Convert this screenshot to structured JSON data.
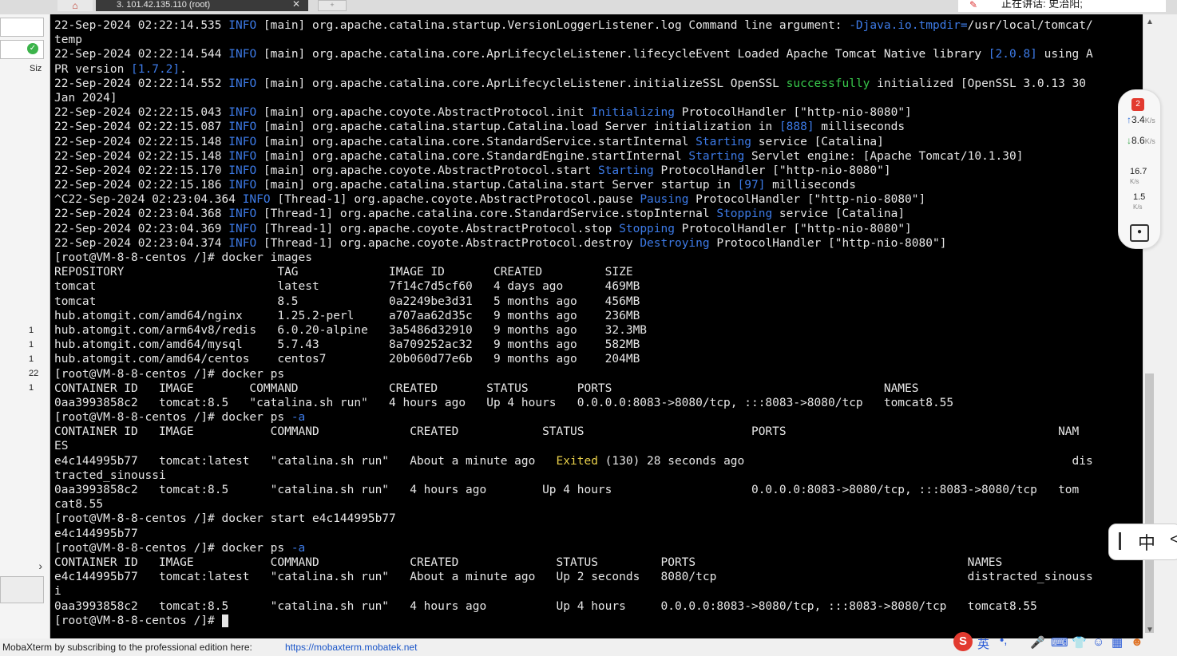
{
  "window": {
    "tab_title": "3. 101.42.135.110 (root)",
    "tab_close": "✕",
    "home_icon": "home-icon",
    "new_tab": "+"
  },
  "overlay": {
    "speaking_label": "正在讲话: 史治阳;"
  },
  "left_panel": {
    "size_label": "Siz",
    "numbers": [
      "1",
      "1",
      "1",
      "22",
      "1"
    ],
    "arrow": "›"
  },
  "terminal_lines": [
    "22-Sep-2024 02:22:14.535 INFO [main] org.apache.catalina.startup.VersionLoggerListener.log Command line argument: -Djava.io.tmpdir=/usr/local/tomcat/",
    "temp",
    "22-Sep-2024 02:22:14.544 INFO [main] org.apache.catalina.core.AprLifecycleListener.lifecycleEvent Loaded Apache Tomcat Native library [2.0.8] using A",
    "PR version [1.7.2].",
    "22-Sep-2024 02:22:14.552 INFO [main] org.apache.catalina.core.AprLifecycleListener.initializeSSL OpenSSL successfully initialized [OpenSSL 3.0.13 30",
    "Jan 2024]",
    "22-Sep-2024 02:22:15.043 INFO [main] org.apache.coyote.AbstractProtocol.init Initializing ProtocolHandler [\"http-nio-8080\"]",
    "22-Sep-2024 02:22:15.087 INFO [main] org.apache.catalina.startup.Catalina.load Server initialization in [888] milliseconds",
    "22-Sep-2024 02:22:15.148 INFO [main] org.apache.catalina.core.StandardService.startInternal Starting service [Catalina]",
    "22-Sep-2024 02:22:15.148 INFO [main] org.apache.catalina.core.StandardEngine.startInternal Starting Servlet engine: [Apache Tomcat/10.1.30]",
    "22-Sep-2024 02:22:15.170 INFO [main] org.apache.coyote.AbstractProtocol.start Starting ProtocolHandler [\"http-nio-8080\"]",
    "22-Sep-2024 02:22:15.186 INFO [main] org.apache.catalina.startup.Catalina.start Server startup in [97] milliseconds",
    "^C22-Sep-2024 02:23:04.364 INFO [Thread-1] org.apache.coyote.AbstractProtocol.pause Pausing ProtocolHandler [\"http-nio-8080\"]",
    "22-Sep-2024 02:23:04.368 INFO [Thread-1] org.apache.catalina.core.StandardService.stopInternal Stopping service [Catalina]",
    "22-Sep-2024 02:23:04.369 INFO [Thread-1] org.apache.coyote.AbstractProtocol.stop Stopping ProtocolHandler [\"http-nio-8080\"]",
    "22-Sep-2024 02:23:04.374 INFO [Thread-1] org.apache.coyote.AbstractProtocol.destroy Destroying ProtocolHandler [\"http-nio-8080\"]",
    "[root@VM-8-8-centos /]# docker images",
    "REPOSITORY                      TAG             IMAGE ID       CREATED         SIZE",
    "tomcat                          latest          7f14c7d5cf60   4 days ago      469MB",
    "tomcat                          8.5             0a2249be3d31   5 months ago    456MB",
    "hub.atomgit.com/amd64/nginx     1.25.2-perl     a707aa62d35c   9 months ago    236MB",
    "hub.atomgit.com/arm64v8/redis   6.0.20-alpine   3a5486d32910   9 months ago    32.3MB",
    "hub.atomgit.com/amd64/mysql     5.7.43          8a709252ac32   9 months ago    582MB",
    "hub.atomgit.com/amd64/centos    centos7         20b060d77e6b   9 months ago    204MB",
    "[root@VM-8-8-centos /]# docker ps",
    "CONTAINER ID   IMAGE        COMMAND             CREATED       STATUS       PORTS                                       NAMES",
    "0aa3993858c2   tomcat:8.5   \"catalina.sh run\"   4 hours ago   Up 4 hours   0.0.0.0:8083->8080/tcp, :::8083->8080/tcp   tomcat8.55",
    "[root@VM-8-8-centos /]# docker ps -a",
    "CONTAINER ID   IMAGE           COMMAND             CREATED            STATUS                        PORTS                                       NAM",
    "ES",
    "e4c144995b77   tomcat:latest   \"catalina.sh run\"   About a minute ago   Exited (130) 28 seconds ago                                               dis",
    "tracted_sinoussi",
    "0aa3993858c2   tomcat:8.5      \"catalina.sh run\"   4 hours ago        Up 4 hours                    0.0.0.0:8083->8080/tcp, :::8083->8080/tcp   tom",
    "cat8.55",
    "[root@VM-8-8-centos /]# docker start e4c144995b77",
    "e4c144995b77",
    "[root@VM-8-8-centos /]# docker ps -a",
    "CONTAINER ID   IMAGE           COMMAND             CREATED              STATUS         PORTS                                       NAMES",
    "e4c144995b77   tomcat:latest   \"catalina.sh run\"   About a minute ago   Up 2 seconds   8080/tcp                                    distracted_sinouss",
    "i",
    "0aa3993858c2   tomcat:8.5      \"catalina.sh run\"   4 hours ago          Up 4 hours     0.0.0.0:8083->8080/tcp, :::8083->8080/tcp   tomcat8.55",
    "[root@VM-8-8-centos /]# "
  ],
  "network_widget": {
    "badge": "2",
    "up_rate": "3.4",
    "up_unit": "K/s",
    "down_rate": "8.6",
    "down_unit": "K/s",
    "up2": "16.7",
    "down2": "1.5",
    "unit_small": "K/s",
    "camera_icon": "camera-icon"
  },
  "ime": {
    "zh": "中",
    "chevron": "<"
  },
  "statusbar": {
    "text": "MobaXterm by subscribing to the professional edition here:",
    "link": "https://mobaxterm.mobatek.net"
  },
  "tray": {
    "sogou": "S",
    "lang": "英",
    "punct": "•,",
    "items": [
      "mic-icon",
      "keyboard-icon",
      "shirt-icon",
      "skin-icon",
      "grid-icon"
    ]
  },
  "colors": {
    "terminal_bg": "#000000",
    "terminal_fg": "#e6e6e6",
    "info": "#3d7be8",
    "yellow": "#e9d04a",
    "green": "#38c94b"
  }
}
